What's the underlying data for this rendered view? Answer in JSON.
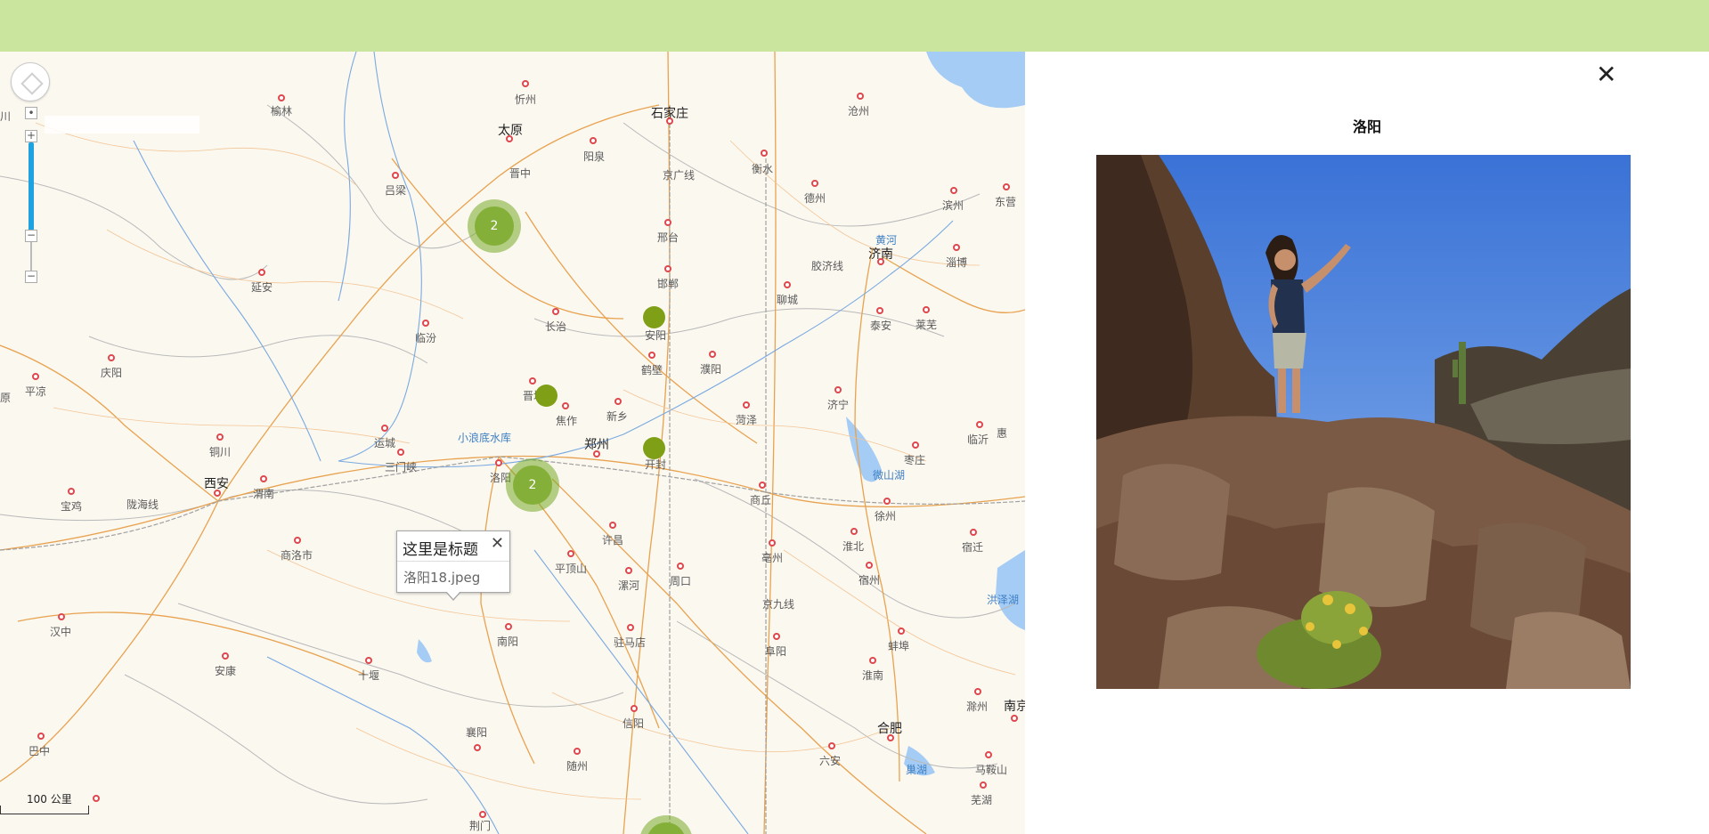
{
  "map": {
    "city_labels": [
      "忻州",
      "石家庄",
      "沧州",
      "榆林",
      "太原",
      "阳泉",
      "衡水",
      "晋中",
      "吕梁",
      "德州",
      "滨州",
      "东营",
      "邢台",
      "黄河",
      "济南",
      "淄博",
      "延安",
      "邯郸",
      "聊城",
      "长治",
      "安阳",
      "泰安",
      "莱芜",
      "临汾",
      "鹤壁",
      "濮阳",
      "庆阳",
      "平凉",
      "晋城",
      "新乡",
      "焦作",
      "济宁",
      "菏泽",
      "临沂",
      "运城",
      "小浪底水库",
      "郑州",
      "开封",
      "铜川",
      "三门峡",
      "洛阳",
      "枣庄",
      "微山湖",
      "西安",
      "渭南",
      "陇海线",
      "商丘",
      "宝鸡",
      "徐州",
      "许昌",
      "淮北",
      "宿迁",
      "商洛市",
      "亳州",
      "平顶山",
      "漯河",
      "周口",
      "宿州",
      "洪泽湖",
      "汉中",
      "南阳",
      "驻马店",
      "阜阳",
      "蚌埠",
      "安康",
      "十堰",
      "淮南",
      "滁州",
      "南京",
      "信阳",
      "合肥",
      "巴中",
      "襄阳",
      "随州",
      "六安",
      "巢湖",
      "马鞍山",
      "芜湖",
      "荆门",
      "京广线",
      "京九线",
      "胶济线"
    ],
    "cluster_counts": [
      "2",
      "2",
      ""
    ],
    "popup": {
      "title": "这里是标题",
      "close": "✕",
      "filename": "洛阳18.jpeg"
    },
    "controls": {
      "zoom_in": "+",
      "zoom_out": "−",
      "scale_label": "100 公里"
    },
    "partial_edge_labels": [
      "川",
      "原",
      "惠"
    ]
  },
  "panel": {
    "close": "✕",
    "title": "洛阳"
  },
  "colors": {
    "topbar": "#cae59d",
    "marker": "#7f9f17",
    "cluster": "#84b039",
    "road": "#e8a24f",
    "rail": "#9a9a9a",
    "water": "#a5ccf5"
  }
}
